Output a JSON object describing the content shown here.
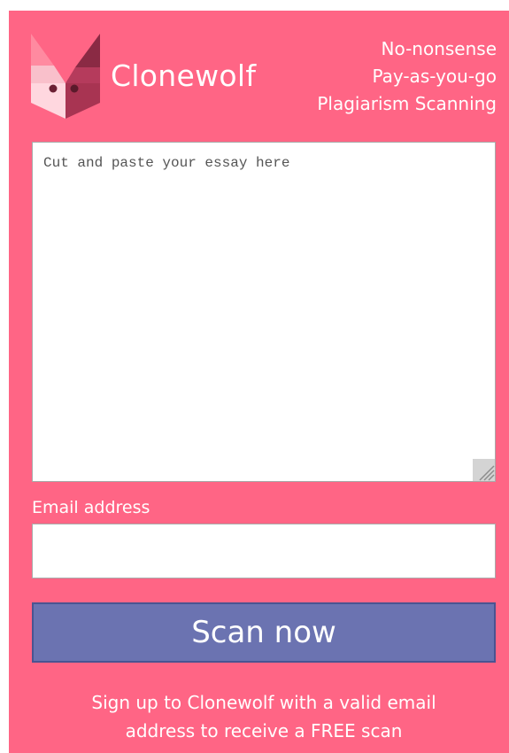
{
  "brand": {
    "name": "Clonewolf",
    "logo_icon": "wolf-head-icon"
  },
  "tagline": {
    "line1": "No-nonsense",
    "line2": "Pay-as-you-go",
    "line3": "Plagiarism Scanning"
  },
  "essay": {
    "placeholder": "Cut and paste your essay here",
    "value": ""
  },
  "email": {
    "label": "Email address",
    "value": ""
  },
  "scan_button": {
    "label": "Scan now"
  },
  "footer": {
    "line1": "Sign up to Clonewolf with a valid email",
    "line2": "address to receive a FREE scan"
  },
  "colors": {
    "panel_background": "#ff6585",
    "button_background": "#6b73b1",
    "button_border": "#4a5491",
    "text": "#ffffff"
  }
}
